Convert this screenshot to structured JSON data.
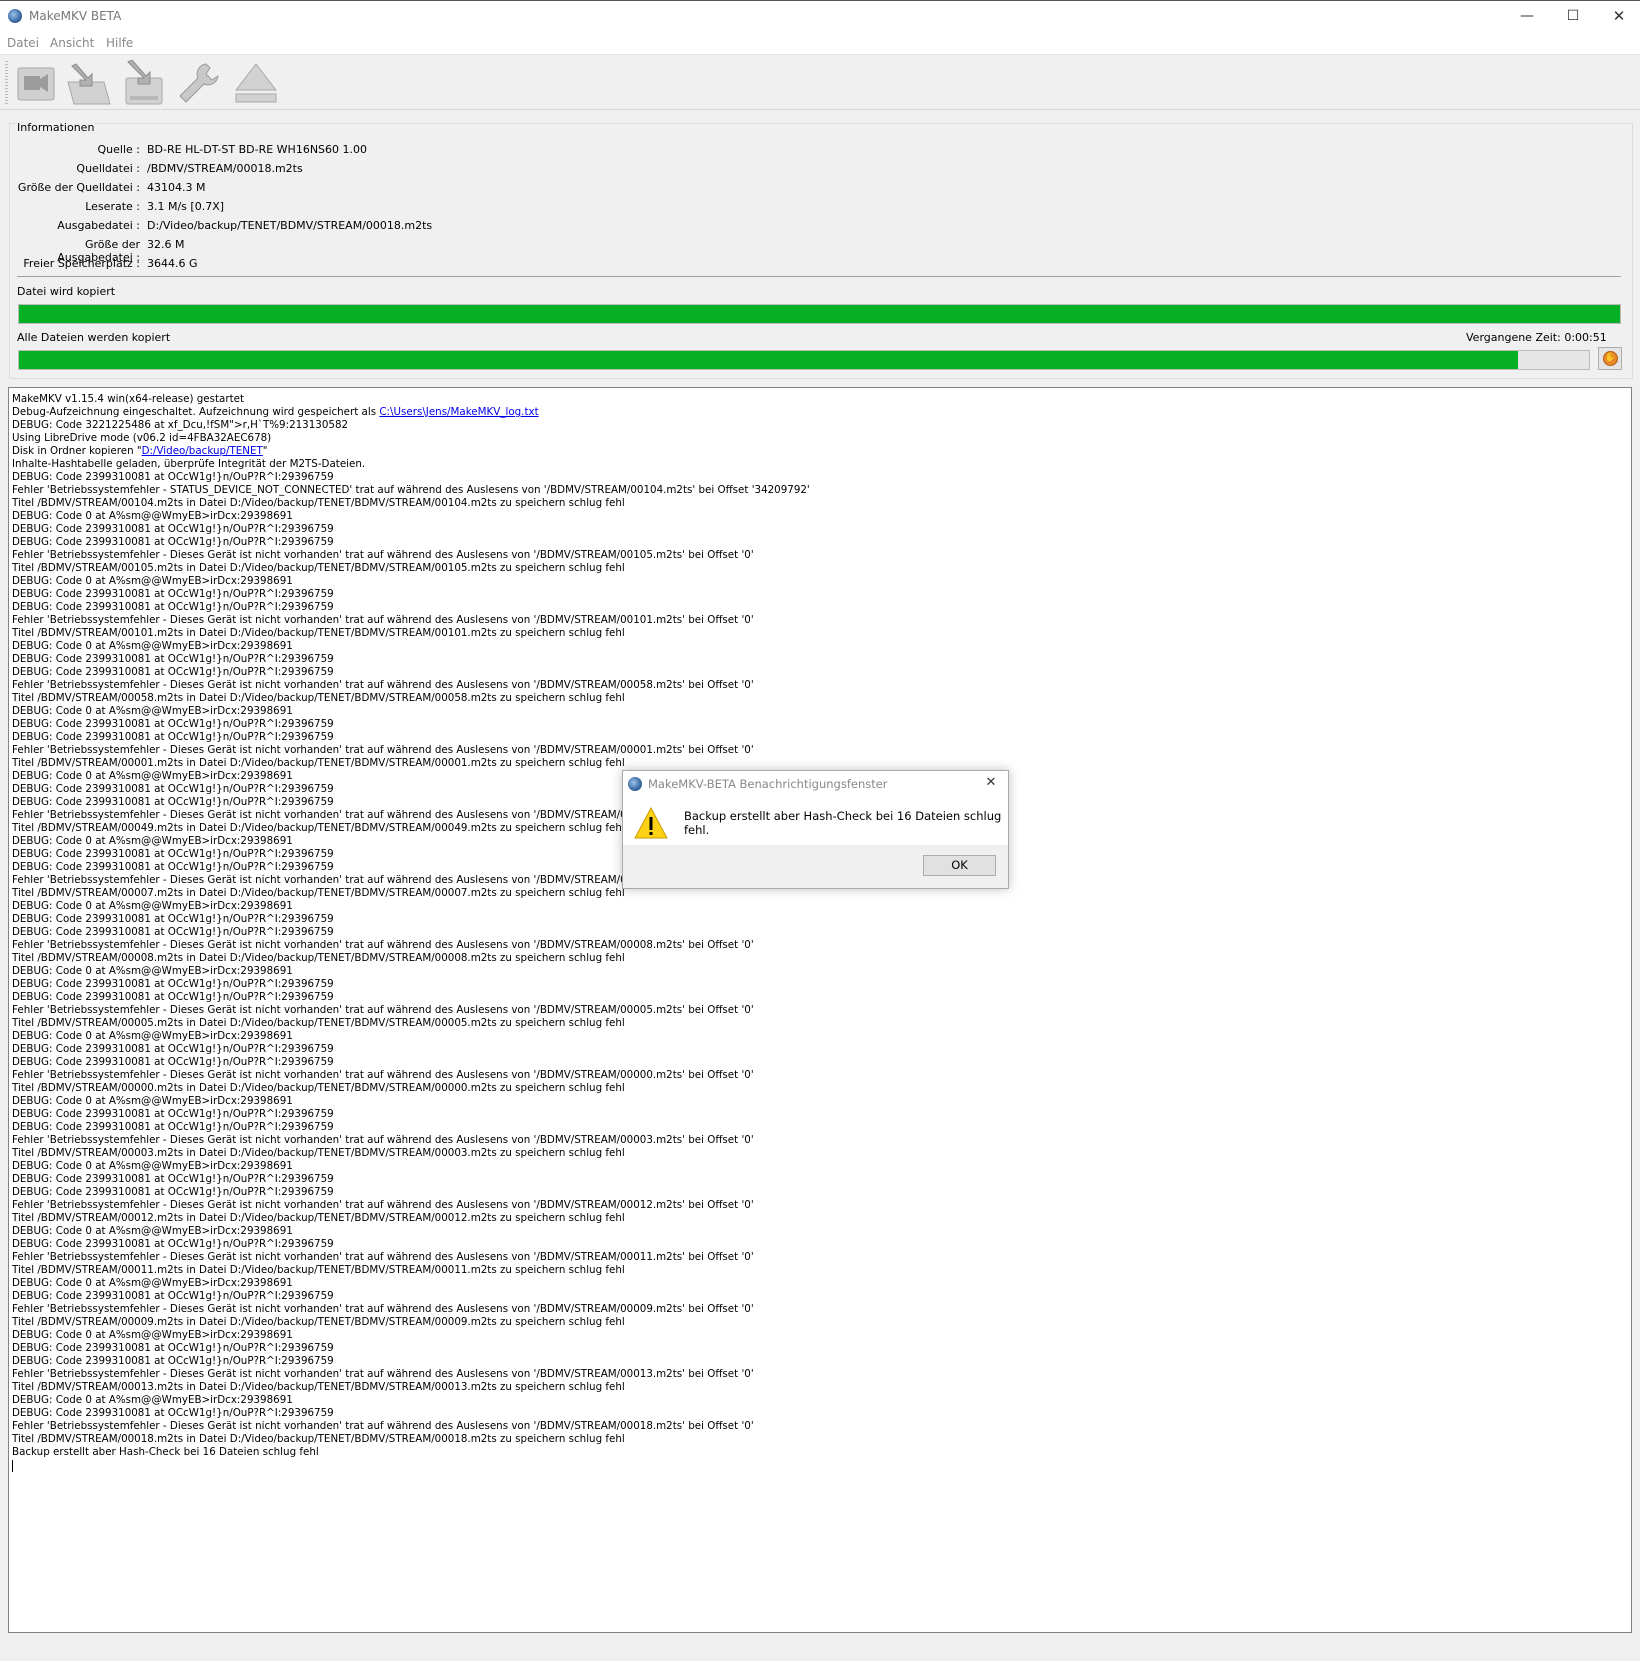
{
  "window": {
    "title": "MakeMKV BETA",
    "minimize": "—",
    "maximize": "☐",
    "close": "✕"
  },
  "menu": [
    "Datei",
    "Ansicht",
    "Hilfe"
  ],
  "toolbar": [
    "open-files-icon",
    "open-disc-icon",
    "backup-icon",
    "preferences-wrench-icon",
    "eject-icon"
  ],
  "info": {
    "group_title": "Informationen",
    "rows": [
      {
        "label": "Quelle :",
        "value": "BD-RE HL-DT-ST BD-RE  WH16NS60 1.00"
      },
      {
        "label": "Quelldatei :",
        "value": "/BDMV/STREAM/00018.m2ts"
      },
      {
        "label": "Größe der Quelldatei :",
        "value": "43104.3 M"
      },
      {
        "label": "Leserate :",
        "value": "3.1 M/s [0.7X]"
      },
      {
        "label": "Ausgabedatei :",
        "value": "D:/Video/backup/TENET/BDMV/STREAM/00018.m2ts"
      },
      {
        "label": "Größe der Ausgabedatei :",
        "value": "32.6 M"
      },
      {
        "label": "Freier Speicherplatz :",
        "value": "3644.6 G"
      }
    ]
  },
  "progress": {
    "current_label": "Datei wird kopiert",
    "current_fraction": 1.0,
    "total_label": "Alle Dateien werden kopiert",
    "total_fraction": 0.955,
    "elapsed": "Vergangene Zeit: 0:00:51",
    "accent": "#06b025"
  },
  "log": {
    "lines": [
      "MakeMKV v1.15.4 win(x64-release) gestartet",
      "Debug-Aufzeichnung eingeschaltet. Aufzeichnung wird gespeichert als ",
      "DEBUG: Code 3221225486 at xf_Dcu,!fSM\">r,H`T%9:213130582",
      "Using LibreDrive mode (v06.2 id=4FBA32AEC678)",
      "Disk in Ordner kopieren \"",
      "Inhalte-Hashtabelle geladen, überprüfe Integrität der M2TS-Dateien.",
      "DEBUG: Code 2399310081 at OCcW1g!}n/OuP?R^I:29396759",
      "Fehler 'Betriebssystemfehler - STATUS_DEVICE_NOT_CONNECTED' trat auf während des Auslesens von '/BDMV/STREAM/00104.m2ts' bei Offset '34209792'",
      "Titel /BDMV/STREAM/00104.m2ts in Datei D:/Video/backup/TENET/BDMV/STREAM/00104.m2ts zu speichern schlug fehl",
      "DEBUG: Code 0 at A%sm@@WmyEB>irDcx:29398691",
      "DEBUG: Code 2399310081 at OCcW1g!}n/OuP?R^I:29396759",
      "DEBUG: Code 2399310081 at OCcW1g!}n/OuP?R^I:29396759",
      "Fehler 'Betriebssystemfehler - Dieses Gerät ist nicht vorhanden' trat auf während des Auslesens von '/BDMV/STREAM/00105.m2ts' bei Offset '0'",
      "Titel /BDMV/STREAM/00105.m2ts in Datei D:/Video/backup/TENET/BDMV/STREAM/00105.m2ts zu speichern schlug fehl",
      "DEBUG: Code 0 at A%sm@@WmyEB>irDcx:29398691",
      "DEBUG: Code 2399310081 at OCcW1g!}n/OuP?R^I:29396759",
      "DEBUG: Code 2399310081 at OCcW1g!}n/OuP?R^I:29396759",
      "Fehler 'Betriebssystemfehler - Dieses Gerät ist nicht vorhanden' trat auf während des Auslesens von '/BDMV/STREAM/00101.m2ts' bei Offset '0'",
      "Titel /BDMV/STREAM/00101.m2ts in Datei D:/Video/backup/TENET/BDMV/STREAM/00101.m2ts zu speichern schlug fehl",
      "DEBUG: Code 0 at A%sm@@WmyEB>irDcx:29398691",
      "DEBUG: Code 2399310081 at OCcW1g!}n/OuP?R^I:29396759",
      "DEBUG: Code 2399310081 at OCcW1g!}n/OuP?R^I:29396759",
      "Fehler 'Betriebssystemfehler - Dieses Gerät ist nicht vorhanden' trat auf während des Auslesens von '/BDMV/STREAM/00058.m2ts' bei Offset '0'",
      "Titel /BDMV/STREAM/00058.m2ts in Datei D:/Video/backup/TENET/BDMV/STREAM/00058.m2ts zu speichern schlug fehl",
      "DEBUG: Code 0 at A%sm@@WmyEB>irDcx:29398691",
      "DEBUG: Code 2399310081 at OCcW1g!}n/OuP?R^I:29396759",
      "DEBUG: Code 2399310081 at OCcW1g!}n/OuP?R^I:29396759",
      "Fehler 'Betriebssystemfehler - Dieses Gerät ist nicht vorhanden' trat auf während des Auslesens von '/BDMV/STREAM/00001.m2ts' bei Offset '0'",
      "Titel /BDMV/STREAM/00001.m2ts in Datei D:/Video/backup/TENET/BDMV/STREAM/00001.m2ts zu speichern schlug fehl",
      "DEBUG: Code 0 at A%sm@@WmyEB>irDcx:29398691",
      "DEBUG: Code 2399310081 at OCcW1g!}n/OuP?R^I:29396759",
      "DEBUG: Code 2399310081 at OCcW1g!}n/OuP?R^I:29396759",
      "Fehler 'Betriebssystemfehler - Dieses Gerät ist nicht vorhanden' trat auf während des Auslesens von '/BDMV/STREAM/00049.m2ts' bei Offset '0'",
      "Titel /BDMV/STREAM/00049.m2ts in Datei D:/Video/backup/TENET/BDMV/STREAM/00049.m2ts zu speichern schlug fehl",
      "DEBUG: Code 0 at A%sm@@WmyEB>irDcx:29398691",
      "DEBUG: Code 2399310081 at OCcW1g!}n/OuP?R^I:29396759",
      "DEBUG: Code 2399310081 at OCcW1g!}n/OuP?R^I:29396759",
      "Fehler 'Betriebssystemfehler - Dieses Gerät ist nicht vorhanden' trat auf während des Auslesens von '/BDMV/STREAM/00007.m2ts' bei Offset '0'",
      "Titel /BDMV/STREAM/00007.m2ts in Datei D:/Video/backup/TENET/BDMV/STREAM/00007.m2ts zu speichern schlug fehl",
      "DEBUG: Code 0 at A%sm@@WmyEB>irDcx:29398691",
      "DEBUG: Code 2399310081 at OCcW1g!}n/OuP?R^I:29396759",
      "DEBUG: Code 2399310081 at OCcW1g!}n/OuP?R^I:29396759",
      "Fehler 'Betriebssystemfehler - Dieses Gerät ist nicht vorhanden' trat auf während des Auslesens von '/BDMV/STREAM/00008.m2ts' bei Offset '0'",
      "Titel /BDMV/STREAM/00008.m2ts in Datei D:/Video/backup/TENET/BDMV/STREAM/00008.m2ts zu speichern schlug fehl",
      "DEBUG: Code 0 at A%sm@@WmyEB>irDcx:29398691",
      "DEBUG: Code 2399310081 at OCcW1g!}n/OuP?R^I:29396759",
      "DEBUG: Code 2399310081 at OCcW1g!}n/OuP?R^I:29396759",
      "Fehler 'Betriebssystemfehler - Dieses Gerät ist nicht vorhanden' trat auf während des Auslesens von '/BDMV/STREAM/00005.m2ts' bei Offset '0'",
      "Titel /BDMV/STREAM/00005.m2ts in Datei D:/Video/backup/TENET/BDMV/STREAM/00005.m2ts zu speichern schlug fehl",
      "DEBUG: Code 0 at A%sm@@WmyEB>irDcx:29398691",
      "DEBUG: Code 2399310081 at OCcW1g!}n/OuP?R^I:29396759",
      "DEBUG: Code 2399310081 at OCcW1g!}n/OuP?R^I:29396759",
      "Fehler 'Betriebssystemfehler - Dieses Gerät ist nicht vorhanden' trat auf während des Auslesens von '/BDMV/STREAM/00000.m2ts' bei Offset '0'",
      "Titel /BDMV/STREAM/00000.m2ts in Datei D:/Video/backup/TENET/BDMV/STREAM/00000.m2ts zu speichern schlug fehl",
      "DEBUG: Code 0 at A%sm@@WmyEB>irDcx:29398691",
      "DEBUG: Code 2399310081 at OCcW1g!}n/OuP?R^I:29396759",
      "DEBUG: Code 2399310081 at OCcW1g!}n/OuP?R^I:29396759",
      "Fehler 'Betriebssystemfehler - Dieses Gerät ist nicht vorhanden' trat auf während des Auslesens von '/BDMV/STREAM/00003.m2ts' bei Offset '0'",
      "Titel /BDMV/STREAM/00003.m2ts in Datei D:/Video/backup/TENET/BDMV/STREAM/00003.m2ts zu speichern schlug fehl",
      "DEBUG: Code 0 at A%sm@@WmyEB>irDcx:29398691",
      "DEBUG: Code 2399310081 at OCcW1g!}n/OuP?R^I:29396759",
      "DEBUG: Code 2399310081 at OCcW1g!}n/OuP?R^I:29396759",
      "Fehler 'Betriebssystemfehler - Dieses Gerät ist nicht vorhanden' trat auf während des Auslesens von '/BDMV/STREAM/00012.m2ts' bei Offset '0'",
      "Titel /BDMV/STREAM/00012.m2ts in Datei D:/Video/backup/TENET/BDMV/STREAM/00012.m2ts zu speichern schlug fehl",
      "DEBUG: Code 0 at A%sm@@WmyEB>irDcx:29398691",
      "DEBUG: Code 2399310081 at OCcW1g!}n/OuP?R^I:29396759",
      "Fehler 'Betriebssystemfehler - Dieses Gerät ist nicht vorhanden' trat auf während des Auslesens von '/BDMV/STREAM/00011.m2ts' bei Offset '0'",
      "Titel /BDMV/STREAM/00011.m2ts in Datei D:/Video/backup/TENET/BDMV/STREAM/00011.m2ts zu speichern schlug fehl",
      "DEBUG: Code 0 at A%sm@@WmyEB>irDcx:29398691",
      "DEBUG: Code 2399310081 at OCcW1g!}n/OuP?R^I:29396759",
      "Fehler 'Betriebssystemfehler - Dieses Gerät ist nicht vorhanden' trat auf während des Auslesens von '/BDMV/STREAM/00009.m2ts' bei Offset '0'",
      "Titel /BDMV/STREAM/00009.m2ts in Datei D:/Video/backup/TENET/BDMV/STREAM/00009.m2ts zu speichern schlug fehl",
      "DEBUG: Code 0 at A%sm@@WmyEB>irDcx:29398691",
      "DEBUG: Code 2399310081 at OCcW1g!}n/OuP?R^I:29396759",
      "DEBUG: Code 2399310081 at OCcW1g!}n/OuP?R^I:29396759",
      "Fehler 'Betriebssystemfehler - Dieses Gerät ist nicht vorhanden' trat auf während des Auslesens von '/BDMV/STREAM/00013.m2ts' bei Offset '0'",
      "Titel /BDMV/STREAM/00013.m2ts in Datei D:/Video/backup/TENET/BDMV/STREAM/00013.m2ts zu speichern schlug fehl",
      "DEBUG: Code 0 at A%sm@@WmyEB>irDcx:29398691",
      "DEBUG: Code 2399310081 at OCcW1g!}n/OuP?R^I:29396759",
      "Fehler 'Betriebssystemfehler - Dieses Gerät ist nicht vorhanden' trat auf während des Auslesens von '/BDMV/STREAM/00018.m2ts' bei Offset '0'",
      "Titel /BDMV/STREAM/00018.m2ts in Datei D:/Video/backup/TENET/BDMV/STREAM/00018.m2ts zu speichern schlug fehl",
      "Backup erstellt aber Hash-Check bei 16 Dateien schlug fehl"
    ],
    "links": {
      "1": {
        "text": "C:\\Users\\Jens/MakeMKV_log.txt",
        "suffix": ""
      },
      "4": {
        "text": "D:/Video/backup/TENET",
        "suffix": "\""
      }
    }
  },
  "dialog": {
    "title": "MakeMKV-BETA Benachrichtigungsfenster",
    "message": "Backup erstellt aber Hash-Check bei 16 Dateien schlug fehl.",
    "ok": "OK",
    "close": "✕",
    "icon": "warning-icon"
  }
}
